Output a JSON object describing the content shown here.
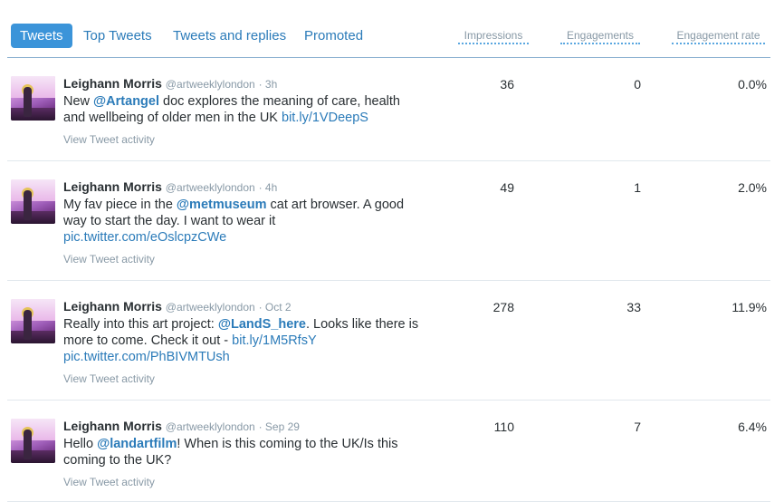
{
  "tabs": [
    {
      "label": "Tweets",
      "active": true
    },
    {
      "label": "Top Tweets",
      "active": false
    },
    {
      "label": "Tweets and replies",
      "active": false
    },
    {
      "label": "Promoted",
      "active": false
    }
  ],
  "columns": {
    "impressions": "Impressions",
    "engagements": "Engagements",
    "engagement_rate": "Engagement rate"
  },
  "colors": {
    "accent": "#3b94d9",
    "link": "#2b7bb9",
    "muted": "#8899a6"
  },
  "activity_label": "View Tweet activity",
  "tweets": [
    {
      "name": "Leighann Morris",
      "handle": "@artweeklylondon",
      "time": "· 3h",
      "text": [
        {
          "t": "New "
        },
        {
          "t": "@Artangel",
          "k": "mention"
        },
        {
          "t": " doc explores the meaning of care, health and wellbeing of older men in the UK "
        },
        {
          "t": "bit.ly/1VDeepS",
          "k": "link"
        }
      ],
      "impressions": "36",
      "engagements": "0",
      "engagement_rate": "0.0%"
    },
    {
      "name": "Leighann Morris",
      "handle": "@artweeklylondon",
      "time": "· 4h",
      "text": [
        {
          "t": "My fav piece in the "
        },
        {
          "t": "@metmuseum",
          "k": "mention"
        },
        {
          "t": " cat art browser. A good way to start the day. I want to wear it "
        },
        {
          "t": "pic.twitter.com/eOslcpzCWe",
          "k": "link"
        }
      ],
      "impressions": "49",
      "engagements": "1",
      "engagement_rate": "2.0%"
    },
    {
      "name": "Leighann Morris",
      "handle": "@artweeklylondon",
      "time": "· Oct 2",
      "text": [
        {
          "t": "Really into this art project: "
        },
        {
          "t": "@LandS_here",
          "k": "mention"
        },
        {
          "t": ". Looks like there is more to come. Check it out - "
        },
        {
          "t": "bit.ly/1M5RfsY",
          "k": "link"
        },
        {
          "t": " "
        },
        {
          "t": "pic.twitter.com/PhBIVMTUsh",
          "k": "link"
        }
      ],
      "impressions": "278",
      "engagements": "33",
      "engagement_rate": "11.9%"
    },
    {
      "name": "Leighann Morris",
      "handle": "@artweeklylondon",
      "time": "· Sep 29",
      "text": [
        {
          "t": "Hello "
        },
        {
          "t": "@landartfilm",
          "k": "mention"
        },
        {
          "t": "! When is this coming to the UK/Is this coming to the UK?"
        }
      ],
      "impressions": "110",
      "engagements": "7",
      "engagement_rate": "6.4%"
    }
  ]
}
